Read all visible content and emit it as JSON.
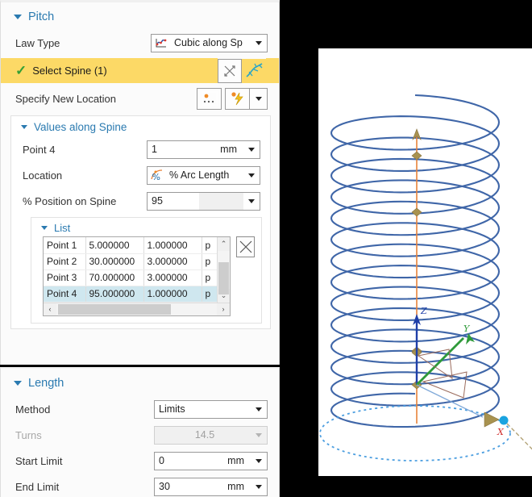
{
  "pitch": {
    "title": "Pitch",
    "law_type": {
      "label": "Law Type",
      "value": "Cubic along Sp",
      "icon": "law-curve-icon"
    },
    "select_spine": {
      "label": "Select Spine (1)",
      "check": "✓",
      "icon_reset": "crosshair-arrows-icon",
      "icon_spine": "spine-curve-icon"
    },
    "specify_new_location": {
      "label": "Specify New Location",
      "icon_points": "point-set-icon",
      "icon_snap": "snap-point-icon"
    },
    "values_along_spine": {
      "title": "Values along Spine",
      "point": {
        "label": "Point 4",
        "value": "1",
        "unit": "mm"
      },
      "location": {
        "label": "Location",
        "value": "% Arc Length",
        "icon": "percent-arc-icon"
      },
      "position": {
        "label": "% Position on Spine",
        "value": "95"
      },
      "list": {
        "title": "List",
        "rows": [
          {
            "name": "Point 1",
            "position": "5.000000",
            "value": "1.000000",
            "extra": "p",
            "selected": false
          },
          {
            "name": "Point 2",
            "position": "30.000000",
            "value": "3.000000",
            "extra": "p",
            "selected": false
          },
          {
            "name": "Point 3",
            "position": "70.000000",
            "value": "3.000000",
            "extra": "p",
            "selected": false
          },
          {
            "name": "Point 4",
            "position": "95.000000",
            "value": "1.000000",
            "extra": "p",
            "selected": true
          }
        ],
        "delete_icon": "close-x-icon",
        "scroll_up": "⌃",
        "scroll_down": "⌄",
        "scroll_left": "‹",
        "scroll_right": "›"
      }
    }
  },
  "length": {
    "title": "Length",
    "method": {
      "label": "Method",
      "value": "Limits"
    },
    "turns": {
      "label": "Turns",
      "value": "14.5",
      "disabled": true
    },
    "start_limit": {
      "label": "Start Limit",
      "value": "0",
      "unit": "mm"
    },
    "end_limit": {
      "label": "End Limit",
      "value": "30",
      "unit": "mm"
    }
  },
  "viewport": {
    "name": "helix-3d-view",
    "axis_labels": {
      "x": "X",
      "y": "Y",
      "z": "Z"
    },
    "colors": {
      "helix": "#3f66a8",
      "spine": "#e8833a",
      "axis_x": "#d03030",
      "axis_y": "#2f9a3a",
      "axis_z": "#1f3fa8",
      "handle": "#1aa3e0",
      "dashed_circle": "#4d9fe0",
      "marker": "#a8924f"
    },
    "helix_turns": 14,
    "markers": 5
  }
}
